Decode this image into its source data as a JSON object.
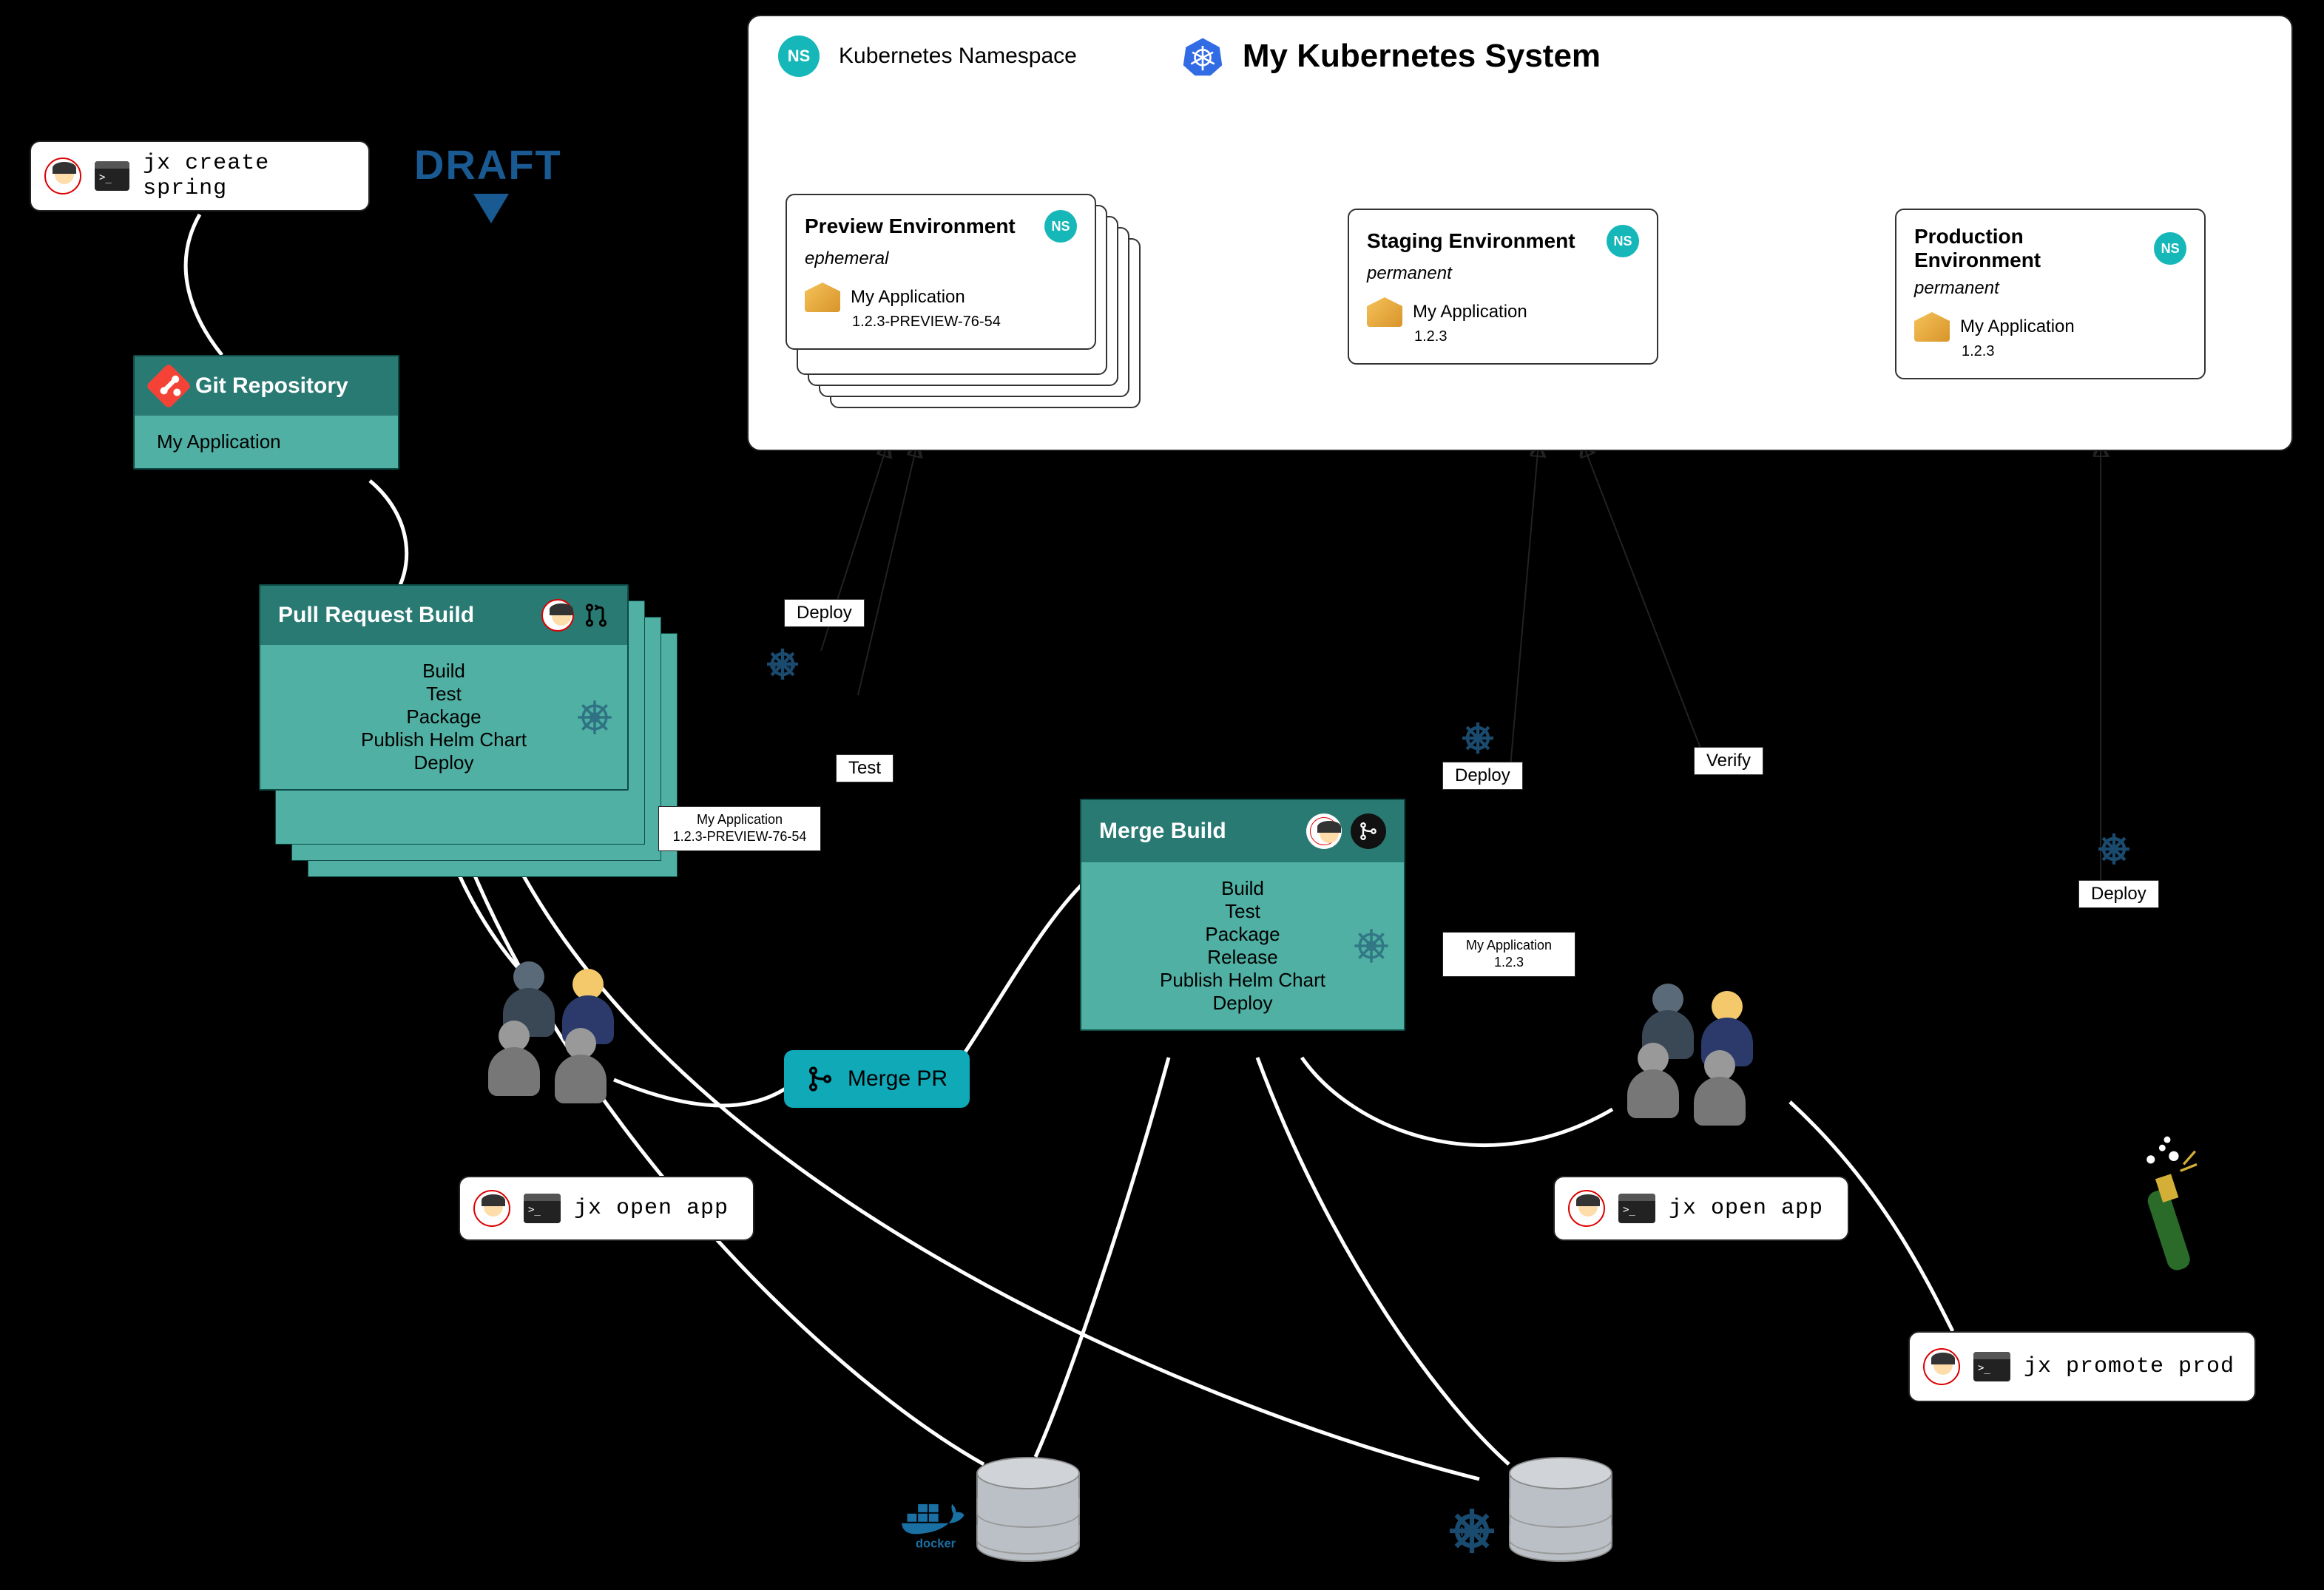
{
  "commands": {
    "create": "jx create spring",
    "open1": "jx open app",
    "open2": "jx open app",
    "promote": "jx promote prod"
  },
  "logos": {
    "draft": "DRAFT"
  },
  "gitRepo": {
    "title": "Git Repository",
    "app": "My Application"
  },
  "prBuild": {
    "title": "Pull Request Build",
    "steps": [
      "Build",
      "Test",
      "Package",
      "Publish Helm Chart",
      "Deploy"
    ],
    "artifact": {
      "name": "My Application",
      "version": "1.2.3-PREVIEW-76-54"
    }
  },
  "mergeBuild": {
    "title": "Merge Build",
    "steps": [
      "Build",
      "Test",
      "Package",
      "Release",
      "Publish Helm Chart",
      "Deploy"
    ],
    "artifact": {
      "name": "My Application",
      "version": "1.2.3"
    }
  },
  "mergePr": "Merge PR",
  "tags": {
    "deploy1": "Deploy",
    "test": "Test",
    "deploy2": "Deploy",
    "verify": "Verify",
    "deploy3": "Deploy"
  },
  "k8s": {
    "nsLabel": "Kubernetes Namespace",
    "nsBadge": "NS",
    "title": "My Kubernetes System",
    "envs": {
      "preview": {
        "title": "Preview Environment",
        "kind": "ephemeral",
        "app": "My Application",
        "ver": "1.2.3-PREVIEW-76-54"
      },
      "staging": {
        "title": "Staging Environment",
        "kind": "permanent",
        "app": "My Application",
        "ver": "1.2.3"
      },
      "prod": {
        "title": "Production Environment",
        "kind": "permanent",
        "app": "My Application",
        "ver": "1.2.3"
      }
    }
  },
  "registries": {
    "docker": "docker",
    "helm": "HELM"
  }
}
